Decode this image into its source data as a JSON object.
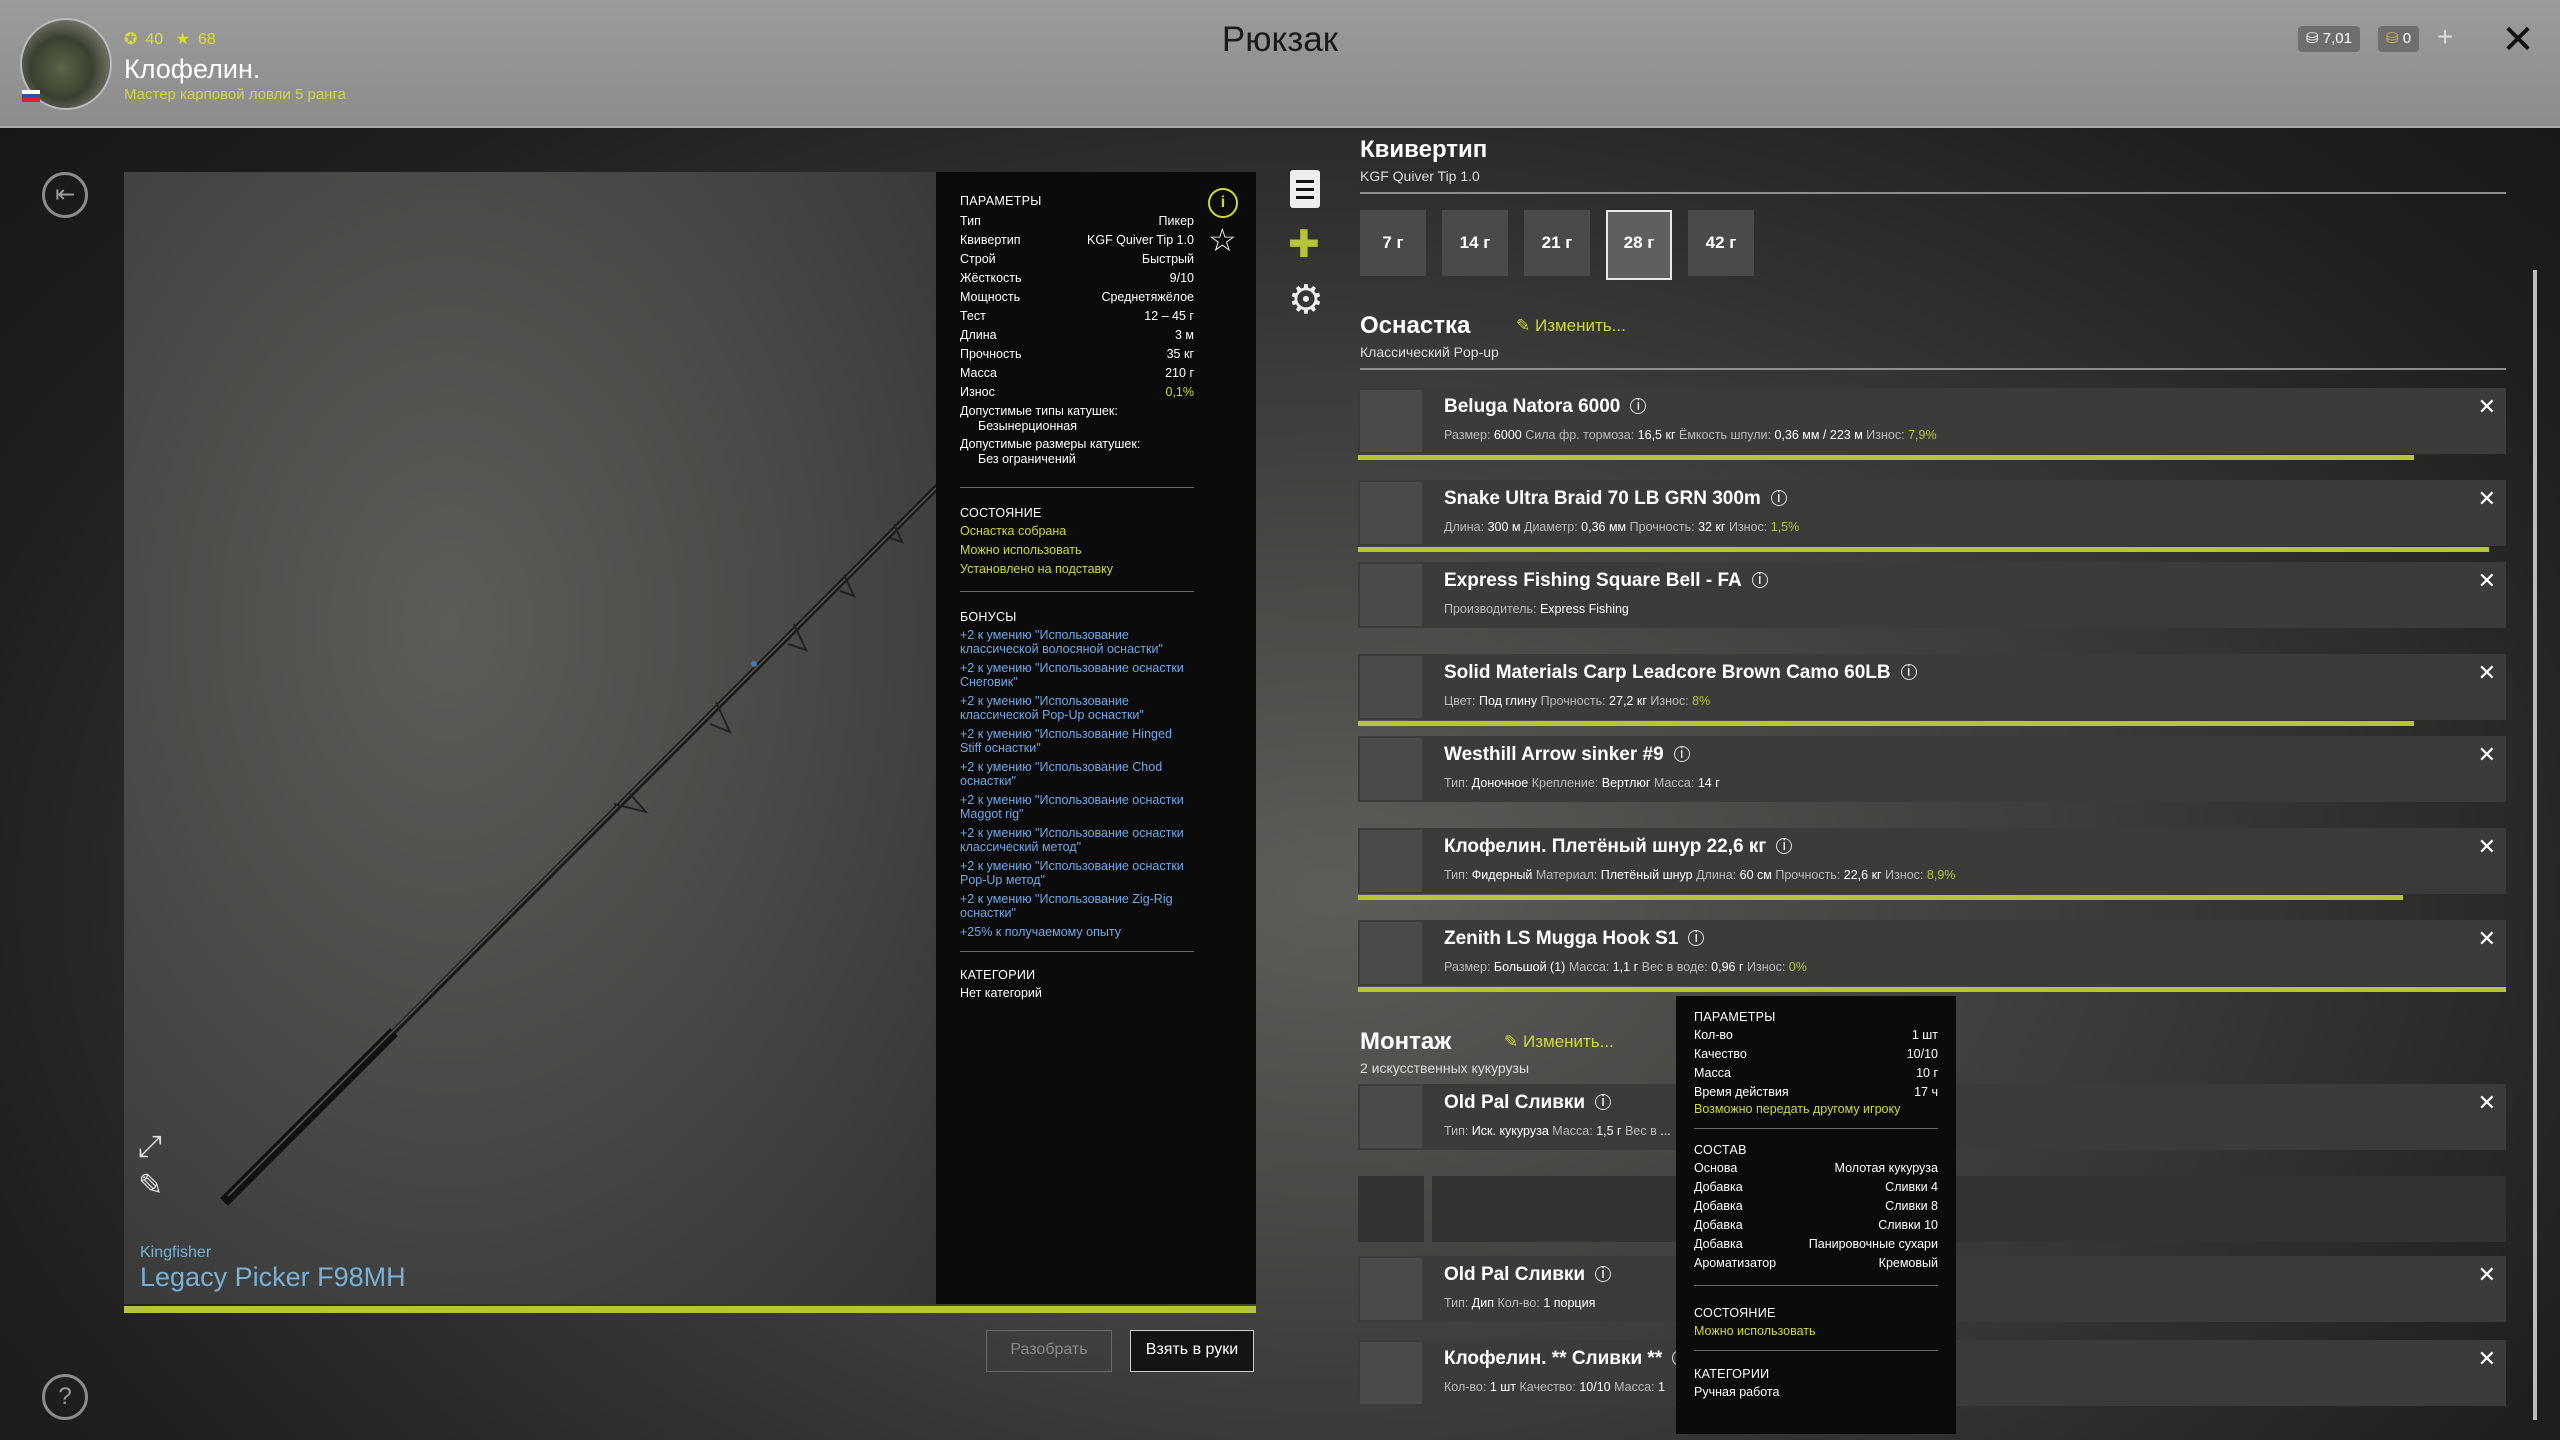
{
  "header": {
    "title": "Рюкзак",
    "player_name": "Клофелин.",
    "rank": "Мастер карповой ловли 5 ранга",
    "level": "40",
    "stars": "68",
    "currency_silver": "7,01",
    "currency_gold": "0"
  },
  "rod": {
    "brand": "Kingfisher",
    "name": "Legacy Picker F98MH"
  },
  "params": {
    "heading": "ПАРАМЕТРЫ",
    "rows": [
      {
        "k": "Тип",
        "v": "Пикер"
      },
      {
        "k": "Квивертип",
        "v": "KGF Quiver Tip 1.0"
      },
      {
        "k": "Строй",
        "v": "Быстрый"
      },
      {
        "k": "Жёсткость",
        "v": "9/10"
      },
      {
        "k": "Мощность",
        "v": "Среднетяжёлое"
      },
      {
        "k": "Тест",
        "v": "12 – 45 г"
      },
      {
        "k": "Длина",
        "v": "3 м"
      },
      {
        "k": "Прочность",
        "v": "35 кг"
      },
      {
        "k": "Масса",
        "v": "210 г"
      },
      {
        "k": "Износ",
        "v": "0,1%"
      }
    ],
    "reel_types_label": "Допустимые типы катушек:",
    "reel_types_value": "Безынерционная",
    "reel_sizes_label": "Допустимые размеры катушек:",
    "reel_sizes_value": "Без ограничений",
    "state_heading": "СОСТОЯНИЕ",
    "state": [
      "Оснастка собрана",
      "Можно использовать",
      "Установлено на подставку"
    ],
    "bonus_heading": "БОНУСЫ",
    "bonuses": [
      "+2 к умению \"Использование классической волосяной оснастки\"",
      "+2 к умению \"Использование оснастки Снеговик\"",
      "+2 к умению \"Использование классической Pop-Up оснастки\"",
      "+2 к умению \"Использование Hinged Stiff оснастки\"",
      "+2 к умению \"Использование Chod оснастки\"",
      "+2 к умению \"Использование оснастки Maggot rig\"",
      "+2 к умению \"Использование оснастки классический метод\"",
      "+2 к умению \"Использование оснастки Pop-Up метод\"",
      "+2 к умению \"Использование Zig-Rig оснастки\"",
      "+25% к получаемому опыту"
    ],
    "cat_heading": "КАТЕГОРИИ",
    "cat_value": "Нет категорий"
  },
  "quiver": {
    "title": "Квивертип",
    "subtitle": "KGF Quiver Tip 1.0",
    "weights": [
      "7 г",
      "14 г",
      "21 г",
      "28 г",
      "42 г"
    ],
    "selected": "28 г"
  },
  "tackle": {
    "title": "Оснастка",
    "edit": "Изменить...",
    "subtitle": "Классический Pop-up",
    "items": [
      {
        "name": "Beluga Natora 6000",
        "details": [
          [
            "Размер:",
            "6000"
          ],
          [
            "Сила фр. тормоза:",
            "16,5 кг"
          ],
          [
            "Ёмкость шпули:",
            "0,36 мм / 223 м"
          ],
          [
            "Износ:",
            "7,9%"
          ]
        ],
        "wear": 0.92
      },
      {
        "name": "Snake Ultra Braid 70 LB GRN 300m",
        "details": [
          [
            "Длина:",
            "300 м"
          ],
          [
            "Диаметр:",
            "0,36 мм"
          ],
          [
            "Прочность:",
            "32 кг"
          ],
          [
            "Износ:",
            "1,5%"
          ]
        ],
        "wear": 0.985
      },
      {
        "name": "Express Fishing Square Bell - FA",
        "details": [
          [
            "Производитель:",
            "Express Fishing"
          ]
        ],
        "wear": null
      },
      {
        "name": "Solid Materials Carp Leadcore Brown Camo 60LB",
        "details": [
          [
            "Цвет:",
            "Под глину"
          ],
          [
            "Прочность:",
            "27,2 кг"
          ],
          [
            "Износ:",
            "8%"
          ]
        ],
        "wear": 0.92
      },
      {
        "name": "Westhill Arrow sinker #9",
        "details": [
          [
            "Тип:",
            "Доночное"
          ],
          [
            "Крепление:",
            "Вертлюг"
          ],
          [
            "Масса:",
            "14 г"
          ]
        ],
        "wear": null
      },
      {
        "name": "Клофелин. Плетёный шнур 22,6 кг",
        "details": [
          [
            "Тип:",
            "Фидерный"
          ],
          [
            "Материал:",
            "Плетёный шнур"
          ],
          [
            "Длина:",
            "60 см"
          ],
          [
            "Прочность:",
            "22,6 кг"
          ],
          [
            "Износ:",
            "8,9%"
          ]
        ],
        "wear": 0.91
      },
      {
        "name": "Zenith LS Mugga Hook S1",
        "details": [
          [
            "Размер:",
            "Большой (1)"
          ],
          [
            "Масса:",
            "1,1 г"
          ],
          [
            "Вес в воде:",
            "0,96 г"
          ],
          [
            "Износ:",
            "0%"
          ]
        ],
        "wear": 1.0
      }
    ]
  },
  "mount": {
    "title": "Монтаж",
    "edit": "Изменить...",
    "subtitle": "2 искусственных кукурузы",
    "items": [
      {
        "name": "Old Pal Сливки",
        "details": [
          [
            "Тип:",
            "Иск. кукуруза"
          ],
          [
            "Масса:",
            "1,5 г"
          ],
          [
            "Вес в",
            "..."
          ]
        ]
      },
      {
        "name": "Old Pal Сливки",
        "details": [
          [
            "Тип:",
            "Дип"
          ],
          [
            "Кол-во:",
            "1 порция"
          ]
        ]
      },
      {
        "name": "Клофелин. ** Сливки **",
        "details": [
          [
            "Кол-во:",
            "1 шт"
          ],
          [
            "Качество:",
            "10/10"
          ],
          [
            "Масса:",
            "1"
          ]
        ]
      }
    ]
  },
  "tooltip": {
    "heading": "ПАРАМЕТРЫ",
    "rows": [
      {
        "k": "Кол-во",
        "v": "1 шт"
      },
      {
        "k": "Качество",
        "v": "10/10"
      },
      {
        "k": "Масса",
        "v": "10 г"
      },
      {
        "k": "Время действия",
        "v": "17 ч"
      }
    ],
    "note": "Возможно передать другому игроку",
    "comp_heading": "СОСТАВ",
    "comp": [
      {
        "k": "Основа",
        "v": "Молотая кукуруза"
      },
      {
        "k": "Добавка",
        "v": "Сливки 4"
      },
      {
        "k": "Добавка",
        "v": "Сливки 8"
      },
      {
        "k": "Добавка",
        "v": "Сливки 10"
      },
      {
        "k": "Добавка",
        "v": "Панировочные сухари"
      },
      {
        "k": "Ароматизатор",
        "v": "Кремовый"
      }
    ],
    "state_heading": "СОСТОЯНИЕ",
    "state": "Можно использовать",
    "cat_heading": "КАТЕГОРИИ",
    "cat": "Ручная работа"
  },
  "buttons": {
    "disassemble": "Разобрать",
    "take": "Взять в руки"
  },
  "colors": {
    "accent": "#b6c43c",
    "yellow": "#cfd83a",
    "blue": "#6fa8e8"
  }
}
